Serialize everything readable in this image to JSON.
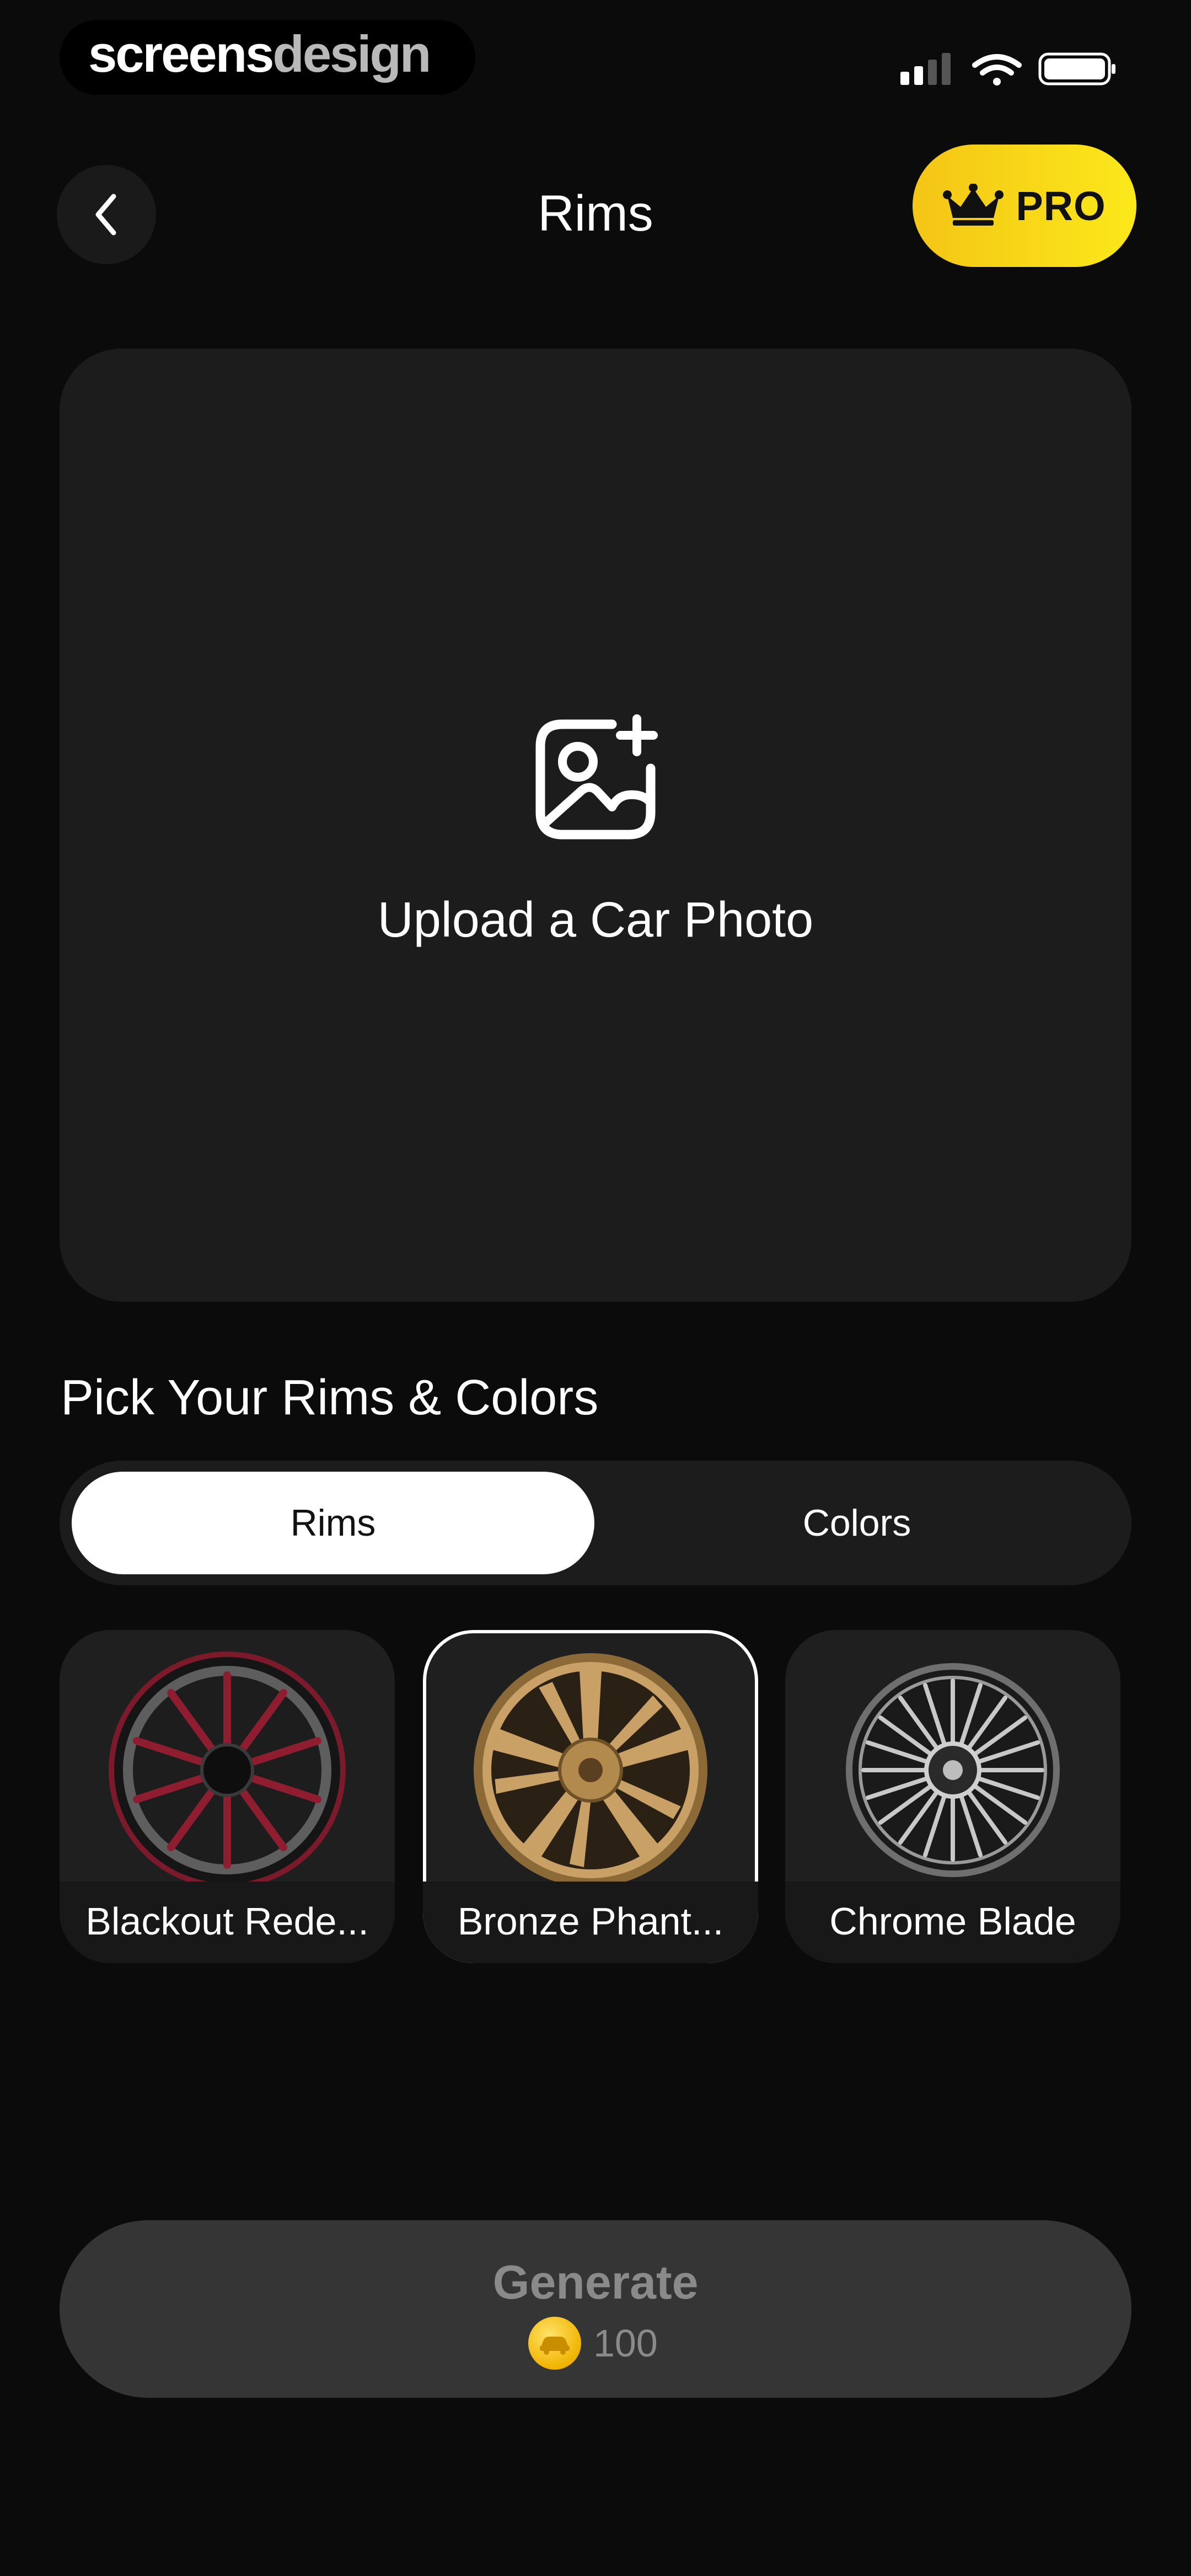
{
  "status_bar": {
    "brand_part1": "screens",
    "brand_part2": "design"
  },
  "header": {
    "title": "Rims",
    "pro_label": "PRO"
  },
  "upload": {
    "label": "Upload a Car Photo"
  },
  "picker": {
    "heading": "Pick Your Rims & Colors",
    "tabs": [
      {
        "label": "Rims",
        "active": true
      },
      {
        "label": "Colors",
        "active": false
      }
    ],
    "rims": [
      {
        "name": "Blackout Rede...",
        "selected": false,
        "accent": "#9b1c2e",
        "finish": "#2a2a2a"
      },
      {
        "name": "Bronze Phant...",
        "selected": true,
        "accent": "#b38a4d",
        "finish": "#c9a066"
      },
      {
        "name": "Chrome Blade",
        "selected": false,
        "accent": "#9a9a9a",
        "finish": "#d0d0d0"
      }
    ]
  },
  "generate": {
    "label": "Generate",
    "cost": "100"
  },
  "colors": {
    "background": "#0b0b0b",
    "card": "#1c1c1c",
    "pro_yellow": "#fbe81a",
    "button_disabled": "#353535"
  },
  "icons": [
    "back-chevron-icon",
    "crown-icon",
    "add-photo-icon",
    "coin-icon",
    "signal-icon",
    "wifi-icon",
    "battery-icon"
  ]
}
